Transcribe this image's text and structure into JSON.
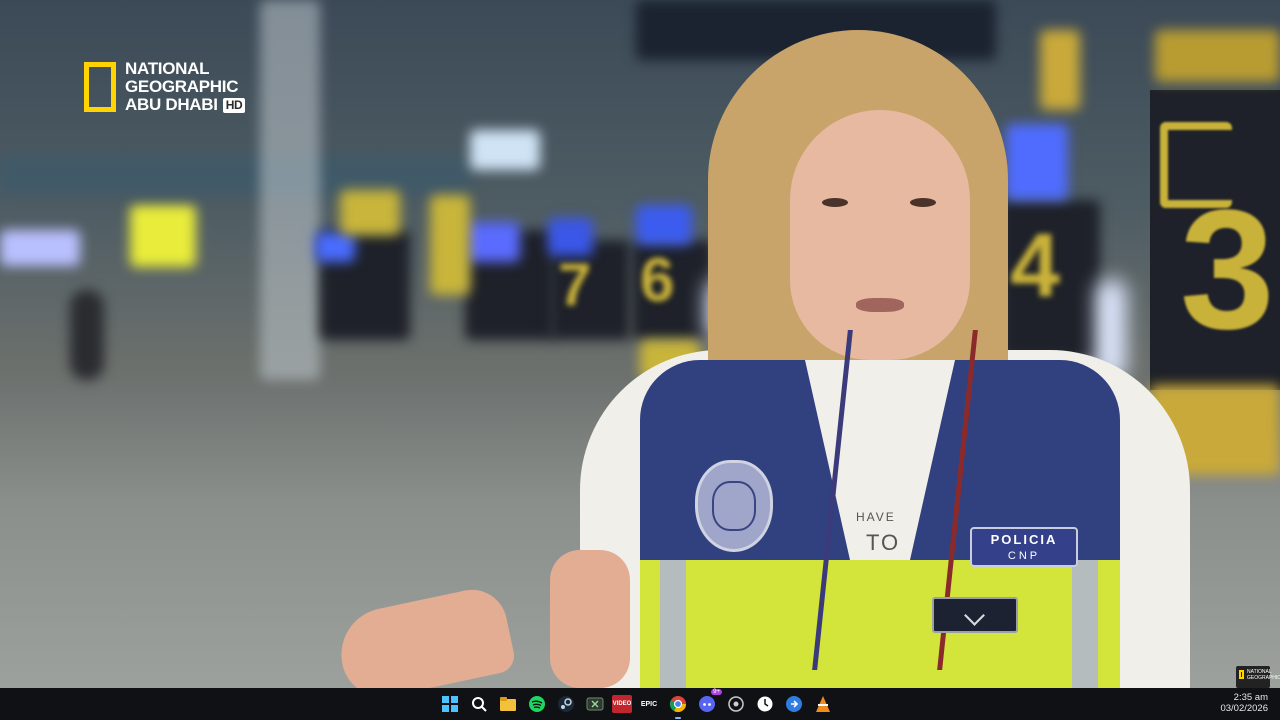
{
  "video": {
    "channel_logo": {
      "line1": "NATIONAL",
      "line2": "GEOGRAPHIC",
      "line3": "ABU DHABI",
      "hd": "HD",
      "accent": "#ffd400"
    },
    "scene": {
      "patch_line1": "POLICIA",
      "patch_line2": "CNP",
      "gate_numbers": [
        "6",
        "7",
        "4",
        "3"
      ],
      "shirt_text_1": "HAVE",
      "shirt_text_2": "TO"
    },
    "watermark_text": "NATIONAL GEOGRAPHIC"
  },
  "taskbar": {
    "apps": [
      {
        "name": "start-icon",
        "label": ""
      },
      {
        "name": "search-icon",
        "label": ""
      },
      {
        "name": "file-explorer-icon",
        "label": ""
      },
      {
        "name": "spotify-icon",
        "label": ""
      },
      {
        "name": "steam-icon",
        "label": ""
      },
      {
        "name": "xbox-icon",
        "label": ""
      },
      {
        "name": "video-app-icon",
        "label": "VIDEO"
      },
      {
        "name": "epic-games-icon",
        "label": "EPIC"
      },
      {
        "name": "chrome-icon",
        "label": ""
      },
      {
        "name": "discord-icon",
        "label": "",
        "badge": "9+"
      },
      {
        "name": "settings-icon",
        "label": ""
      },
      {
        "name": "clock-app-icon",
        "label": ""
      },
      {
        "name": "remote-desktop-icon",
        "label": ""
      },
      {
        "name": "vlc-icon",
        "label": ""
      }
    ],
    "time": "2:35 am",
    "date": "03/02/2026"
  }
}
